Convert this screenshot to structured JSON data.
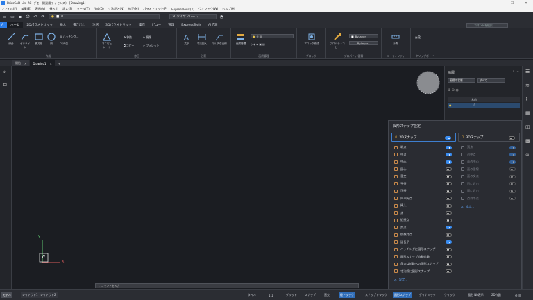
{
  "window": {
    "title": "BricsCAD Lite RC (デモ - 開発用ライセンス) - [Drawing1]",
    "controls": [
      "─",
      "☐",
      "✕"
    ]
  },
  "menu": [
    "ファイル(F)",
    "編集(E)",
    "表示(V)",
    "挿入(I)",
    "設定(S)",
    "ツール(T)",
    "作成(D)",
    "寸法記入(N)",
    "修正(M)",
    "パラメトリック(P)",
    "ExpressTools(X)",
    "ウィンドウ(W)",
    "ヘルプ(H)"
  ],
  "quick_access": {
    "layer_value": "0",
    "visual_style": "2Dワイヤフレーム"
  },
  "ribbon_tabs": [
    "ホーム",
    "2Dパラメトリック",
    "挿入",
    "書き出し",
    "注釈",
    "3Dパラメトリック",
    "操作",
    "ビュー",
    "管理",
    "ExpressTools",
    "AI予測"
  ],
  "search_placeholder": "コマンドを検索",
  "ribbon": {
    "draw": {
      "label": "作成",
      "line": "線分",
      "polyline": "ポリライン",
      "rect": "長方形",
      "circle": "円",
      "hatch": "ハッチング...",
      "arc": "円弧"
    },
    "modify": {
      "label": "修正",
      "quick_modify": "マニピュレート",
      "move": "移動",
      "copy": "コピー",
      "mirror": "鏡像",
      "fillet": "フィレット"
    },
    "annotate": {
      "label": "注釈",
      "text": "文字",
      "dim": "寸法記入",
      "mtext": "マルチ引出線"
    },
    "layers": {
      "label": "画層管理",
      "manager": "画層管理",
      "layer_value": "0"
    },
    "block": {
      "label": "ブロック",
      "create": "ブロック作成"
    },
    "properties": {
      "label": "プロパティ/要素",
      "match": "プロパティコピー",
      "color": "ByLayer",
      "linetype": "—— ByLayer"
    },
    "utilities": {
      "label": "ユーティリティ",
      "measure": "計測"
    },
    "clipboard": {
      "label": "クリップボード"
    }
  },
  "doc_tabs": [
    {
      "label": "開始",
      "active": false
    },
    {
      "label": "Drawing1",
      "active": true
    }
  ],
  "command_line": "：コマンドを入力",
  "ucs": {
    "y": "Y",
    "x": "X",
    "w": "W"
  },
  "layers_panel": {
    "title": "画層",
    "filter": "画層の状態",
    "filter_value": "すべて",
    "col_name": "名前",
    "row_name": "0"
  },
  "snap": {
    "title": "図形スナップ設定",
    "col2d": {
      "header": "2Dスナップ",
      "header_on": true,
      "items": [
        {
          "label": "端点",
          "on": true
        },
        {
          "label": "中点",
          "on": true
        },
        {
          "label": "中心",
          "on": true
        },
        {
          "label": "図心",
          "on": false
        },
        {
          "label": "垂交",
          "on": false
        },
        {
          "label": "平行",
          "on": false
        },
        {
          "label": "正接",
          "on": false
        },
        {
          "label": "四半円点",
          "on": false
        },
        {
          "label": "挿入",
          "on": false
        },
        {
          "label": "点",
          "on": false
        },
        {
          "label": "近接点",
          "on": false
        },
        {
          "label": "交点",
          "on": true
        },
        {
          "label": "仮想交点",
          "on": false
        },
        {
          "label": "延長子",
          "on": true
        },
        {
          "label": "ハッチングに図形スナップ",
          "on": false
        },
        {
          "label": "図形スナップ自動追跡",
          "on": false
        },
        {
          "label": "角点は追跡への図形スナップ",
          "on": false
        },
        {
          "label": "寸法線に図形スナップ",
          "on": false
        }
      ],
      "settings": "設定..."
    },
    "col3d": {
      "header": "3Dスナップ",
      "header_on": false,
      "items": [
        {
          "label": "頂点",
          "on": true
        },
        {
          "label": "辺中点",
          "on": true
        },
        {
          "label": "面の中心",
          "on": true
        },
        {
          "label": "面の垂線",
          "on": false
        },
        {
          "label": "面の交点",
          "on": false
        },
        {
          "label": "辺に近い",
          "on": false
        },
        {
          "label": "面に近い",
          "on": false
        },
        {
          "label": "点群の点",
          "on": false
        }
      ],
      "settings": "設定..."
    }
  },
  "status": {
    "tabs": [
      "モデル",
      "レイアウト1",
      "レイアウト2"
    ],
    "items": [
      {
        "label": "タイル",
        "on": false
      },
      {
        "label": "1:1",
        "on": false
      },
      {
        "label": "グリッド",
        "on": false
      },
      {
        "label": "スナップ",
        "on": false
      },
      {
        "label": "直交",
        "on": false
      },
      {
        "label": "極トラック",
        "on": true
      },
      {
        "label": "スナップトラック",
        "on": false
      },
      {
        "label": "図形スナップ",
        "on": true
      },
      {
        "label": "ダイナミック",
        "on": false
      },
      {
        "label": "クイック",
        "on": false
      },
      {
        "label": "図形 Nb表示",
        "on": false
      },
      {
        "label": "2D作図",
        "on": false
      }
    ]
  }
}
